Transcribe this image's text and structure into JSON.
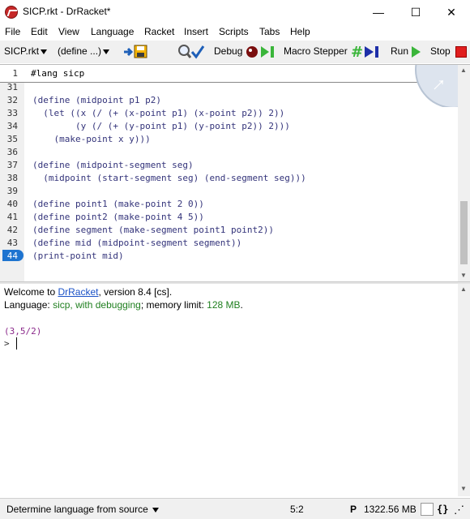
{
  "window": {
    "title": "SICP.rkt - DrRacket*",
    "minimize": "—",
    "maximize": "☐",
    "close": "✕"
  },
  "menu": [
    "File",
    "Edit",
    "View",
    "Language",
    "Racket",
    "Insert",
    "Scripts",
    "Tabs",
    "Help"
  ],
  "toolbar": {
    "file_menu": "SICP.rkt",
    "define_menu": "(define ...)",
    "debug": "Debug",
    "macro_stepper": "Macro Stepper",
    "run": "Run",
    "stop": "Stop"
  },
  "editor": {
    "lang_line_number": "1",
    "lang_line": "#lang sicp",
    "lines": [
      {
        "n": "31",
        "code": ""
      },
      {
        "n": "32",
        "code": "(define (midpoint p1 p2)"
      },
      {
        "n": "33",
        "code": "  (let ((x (/ (+ (x-point p1) (x-point p2)) 2))"
      },
      {
        "n": "34",
        "code": "        (y (/ (+ (y-point p1) (y-point p2)) 2)))"
      },
      {
        "n": "35",
        "code": "    (make-point x y)))"
      },
      {
        "n": "36",
        "code": ""
      },
      {
        "n": "37",
        "code": "(define (midpoint-segment seg)"
      },
      {
        "n": "38",
        "code": "  (midpoint (start-segment seg) (end-segment seg)))"
      },
      {
        "n": "39",
        "code": ""
      },
      {
        "n": "40",
        "code": "(define point1 (make-point 2 0))"
      },
      {
        "n": "41",
        "code": "(define point2 (make-point 4 5))"
      },
      {
        "n": "42",
        "code": "(define segment (make-segment point1 point2))"
      },
      {
        "n": "43",
        "code": "(define mid (midpoint-segment segment))"
      },
      {
        "n": "44",
        "code": "(print-point mid)"
      }
    ]
  },
  "repl": {
    "welcome_prefix": "Welcome to ",
    "welcome_link": "DrRacket",
    "welcome_suffix": ", version 8.4 [cs].",
    "language_prefix": "Language: ",
    "language_name": "sicp, with debugging",
    "language_mid": "; memory limit: ",
    "memory_limit": "128 MB",
    "language_end": ".",
    "output": "(3,5/2)",
    "prompt": ">"
  },
  "status": {
    "language_selector": "Determine language from source",
    "position": "5:2",
    "p_indicator": "P",
    "memory": "1322.56 MB",
    "braces": "{}"
  },
  "colors": {
    "code": "#33337a",
    "number": "#2a8a2a",
    "output": "#8b2a8b",
    "link": "#1b52c7",
    "language": "#1f7f1f",
    "highlight": "#1e74d0"
  }
}
